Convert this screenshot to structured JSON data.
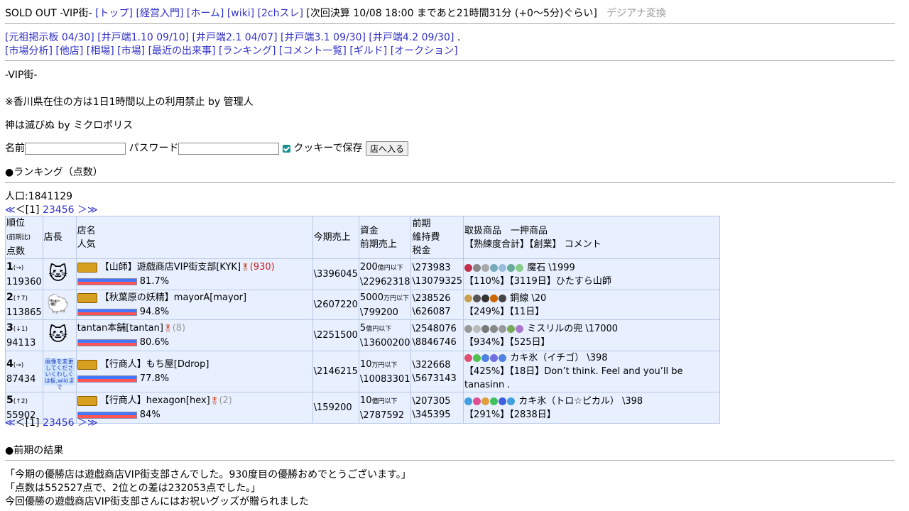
{
  "header": {
    "prefix": "SOLD OUT -VIP街-",
    "links": [
      "[トップ]",
      "[経営入門]",
      "[ホーム]",
      "[wiki]",
      "[2chスレ]"
    ],
    "next_settle": "[次回決算 10/08 18:00 まであと21時間31分 (+0〜5分)ぐらい]",
    "font_toggle": "デジアナ変換"
  },
  "boards": [
    "[元祖掲示板 04/30]",
    "[井戸端1.10 09/10]",
    "[井戸端2.1 04/07]",
    "[井戸端3.1 09/30]",
    "[井戸端4.2 09/30]"
  ],
  "boards_end": ".",
  "menu": [
    "[市場分析]",
    "[他店]",
    "[相場]",
    "[市場]",
    "[最近の出来事]",
    "[ランキング]",
    "[コメント一覧]",
    "[ギルド]",
    "[オークション]"
  ],
  "town": "-VIP街-",
  "notice1": "※香川県在住の方は1日1時間以上の利用禁止 by 管理人",
  "notice2": "神は滅びぬ by ミクロポリス",
  "login": {
    "name_label": "名前",
    "name_value": "",
    "pass_label": "パスワード",
    "pass_value": "",
    "cookie_label": "クッキーで保存",
    "enter_label": "店へ入る"
  },
  "ranking_title": "●ランキング（点数）",
  "population": "人口:1841129",
  "pager": {
    "first": "≪",
    "prev": "＜",
    "current": "[1]",
    "pages": [
      "2",
      "3",
      "4",
      "5",
      "6"
    ],
    "next": "＞",
    "last": "≫"
  },
  "table": {
    "h_rank": "順位",
    "h_rank_sub": "(前期比)",
    "h_points": "点数",
    "h_owner": "店長",
    "h_shop": "店名",
    "h_pop": "人気",
    "h_sales": "今期売上",
    "h_funds": "資金",
    "h_prev_sales": "前期売上",
    "h_prev": "前期",
    "h_upkeep": "維持費",
    "h_tax": "税金",
    "h_goods": "取扱商品　一押商品",
    "h_extra": "【熟練度合計】【創業】 コメント",
    "rows": [
      {
        "rank": "1",
        "change": "(→)",
        "points": "119360",
        "avatar": "🐱",
        "shop": "【山師】遊戯商店VIP街支部[KYK]",
        "wins": "(930)",
        "pop": "81.7%",
        "sales": "\\3396045",
        "funds": "200",
        "funds_unit": "億円以下",
        "prev_sales": "\\22962318",
        "upkeep": "\\273983",
        "tax": "\\13079325",
        "goods_icons": [
          "#c0304a",
          "#888",
          "#aaa",
          "#7ab",
          "#9bd",
          "#6a9",
          "#8c8"
        ],
        "item": "魔石 \\1999",
        "skill": "【110%】",
        "founded": "【3119日】",
        "comment": "ひたすら山師"
      },
      {
        "rank": "2",
        "change": "(↑7)",
        "points": "113865",
        "avatar": "🐑",
        "shop": "【秋葉原の妖精】mayorA[mayor]",
        "wins": "",
        "pop": "94.8%",
        "sales": "\\2607220",
        "funds": "5000",
        "funds_unit": "万円以下",
        "prev_sales": "\\799200",
        "upkeep": "\\238526",
        "tax": "\\626087",
        "goods_icons": [
          "#c8a050",
          "#555",
          "#333",
          "#c60",
          "#444"
        ],
        "item": "銅線 \\20",
        "skill": "【249%】",
        "founded": "【11日】",
        "comment": ""
      },
      {
        "rank": "3",
        "change": "(↓1)",
        "points": "94113",
        "avatar": "🐱",
        "shop": "tantan本舗[tantan]",
        "wins": "(8)",
        "pop": "80.6%",
        "sales": "\\2251500",
        "funds": "5",
        "funds_unit": "億円以下",
        "prev_sales": "\\13600200",
        "upkeep": "\\2548076",
        "tax": "\\8846746",
        "goods_icons": [
          "#999",
          "#bbb",
          "#777",
          "#888",
          "#999",
          "#7a5",
          "#a7c"
        ],
        "item": "ミスリルの兜 \\17000",
        "skill": "【934%】",
        "founded": "【525日】",
        "comment": ""
      },
      {
        "rank": "4",
        "change": "(→)",
        "points": "87434",
        "avatar_text": "画像を変更してくださいくわしくは板,wikiまで",
        "shop": "【行商人】もち屋[Ddrop]",
        "wins": "",
        "pop": "77.8%",
        "sales": "\\2146215",
        "funds": "10",
        "funds_unit": "万円以下",
        "prev_sales": "\\10083301",
        "upkeep": "\\322668",
        "tax": "\\5673143",
        "goods_icons": [
          "#e05070",
          "#50c050",
          "#5080e0",
          "#7070e0",
          "#5080e0"
        ],
        "item": "カキ氷（イチゴ） \\398",
        "skill": "【425%】",
        "founded": "【18日】",
        "comment": "Don’t think. Feel and you’ll be tanasinn ."
      },
      {
        "rank": "5",
        "change": "(↑2)",
        "points": "55902",
        "avatar": "",
        "shop": "【行商人】hexagon[hex]",
        "wins": "(2)",
        "pop": "84%",
        "sales": "\\159200",
        "funds": "10",
        "funds_unit": "億円以下",
        "prev_sales": "\\2787592",
        "upkeep": "\\207305",
        "tax": "\\345395",
        "goods_icons": [
          "#40a0e0",
          "#e05090",
          "#e0a040",
          "#40c060",
          "#4060e0",
          "#40a0e0"
        ],
        "item": "カキ氷（トロ☆ピカル） \\398",
        "skill": "【291%】",
        "founded": "【2838日】",
        "comment": ""
      }
    ]
  },
  "results_title": "●前期の結果",
  "results": [
    "「今期の優勝店は遊戯商店VIP街支部さんでした。930度目の優勝おめでとうございます。」",
    "「点数は552527点で、2位との差は232053点でした。」",
    "今回優勝の遊戯商店VIP街支部さんにはお祝いグッズが贈られました"
  ]
}
